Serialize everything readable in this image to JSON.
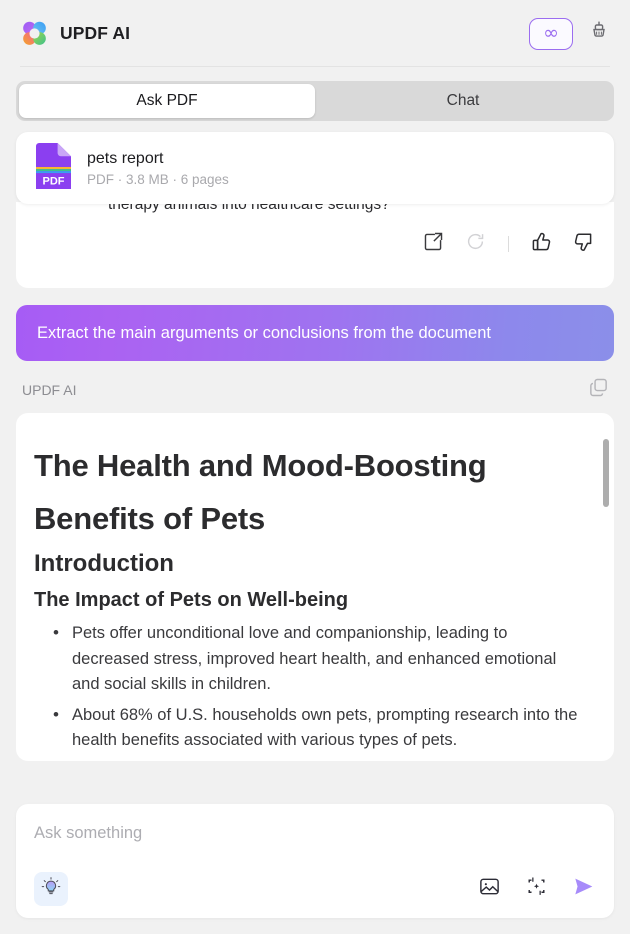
{
  "header": {
    "brand_name": "UPDF AI",
    "logo_icon": "updf-clover-logo",
    "infinity_icon": "infinity-icon",
    "infinity_label": "∞",
    "brush_icon": "clear-brush-icon",
    "accent_purple": "#9b6df0"
  },
  "tabs": [
    {
      "label": "Ask PDF",
      "active": true
    },
    {
      "label": "Chat",
      "active": false
    }
  ],
  "file": {
    "badge": "PDF",
    "title": "pets report",
    "subtitle": "PDF · 3.8 MB · 6 pages",
    "icon": "pdf-file-icon"
  },
  "previous_message": {
    "text": "therapy animals into healthcare settings?",
    "actions": [
      {
        "name": "share-icon",
        "title": "Open"
      },
      {
        "name": "regenerate-icon",
        "title": "Regenerate"
      },
      {
        "name": "thumbs-up-icon",
        "title": "Good response"
      },
      {
        "name": "thumbs-down-icon",
        "title": "Bad response"
      }
    ]
  },
  "user_message": {
    "text": "Extract the main arguments or conclusions from the document",
    "gradient_from": "#a65cf5",
    "gradient_to": "#8b8fe9"
  },
  "assistant": {
    "label": "UPDF AI",
    "copy_icon": "copy-icon",
    "document": {
      "h1": "The Health and Mood-Boosting Benefits of Pets",
      "h2": "Introduction",
      "h3": "The Impact of Pets on Well-being",
      "bullets": [
        "Pets offer unconditional love and companionship, leading to decreased stress, improved heart health, and enhanced emotional and social skills in children.",
        "About 68% of U.S. households own pets, prompting research into the health benefits associated with various types of pets."
      ]
    }
  },
  "composer": {
    "placeholder": "Ask something",
    "value": "",
    "bulb_icon": "lightbulb-icon",
    "image_icon": "image-icon",
    "scan_icon": "ai-scan-icon",
    "send_icon": "send-icon",
    "send_color": "#a78bfa"
  }
}
